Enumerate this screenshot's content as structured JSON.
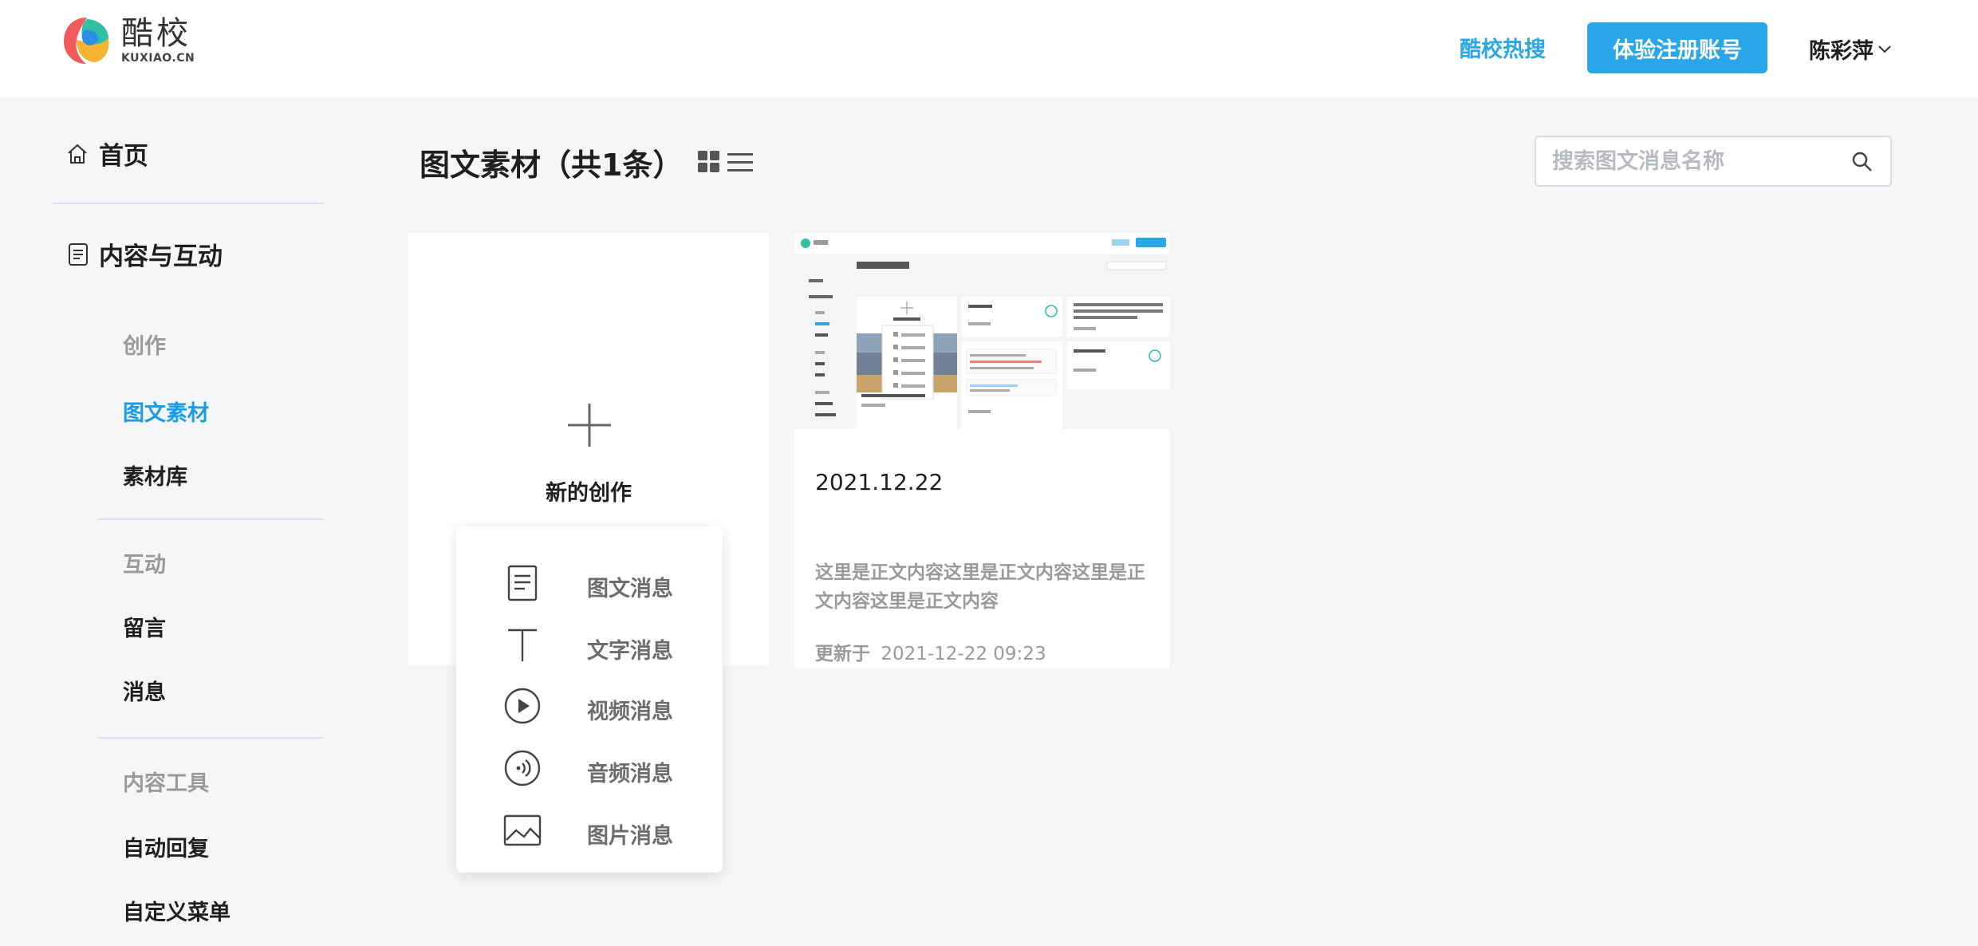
{
  "header": {
    "logo_cn": "酷校",
    "logo_en": "KUXIAO.CN",
    "hot_link": "酷校热搜",
    "register_button": "体验注册账号",
    "user_name": "陈彩萍"
  },
  "sidebar": {
    "home": "首页",
    "content_section": "内容与互动",
    "groups": [
      {
        "title": "创作",
        "items": [
          "图文素材",
          "素材库"
        ]
      },
      {
        "title": "互动",
        "items": [
          "留言",
          "消息"
        ]
      },
      {
        "title": "内容工具",
        "items": [
          "自动回复",
          "自定义菜单"
        ]
      }
    ],
    "active_item": "图文素材"
  },
  "main": {
    "title": "图文素材（共1条）",
    "search_placeholder": "搜索图文消息名称",
    "create_card": {
      "label": "新的创作"
    },
    "create_menu": [
      {
        "label": "图文消息",
        "icon": "document-icon"
      },
      {
        "label": "文字消息",
        "icon": "text-icon"
      },
      {
        "label": "视频消息",
        "icon": "play-circle-icon"
      },
      {
        "label": "音频消息",
        "icon": "audio-circle-icon"
      },
      {
        "label": "图片消息",
        "icon": "image-icon"
      }
    ],
    "material_card": {
      "title": "2021.12.22",
      "body": "这里是正文内容这里是正文内容这里是正文内容这里是正文内容",
      "updated_label": "更新于",
      "updated_time": "2021-12-22 09:23"
    }
  },
  "colors": {
    "accent": "#28a6e8",
    "active_nav": "#1a9be6",
    "background": "#f5f6f8"
  }
}
